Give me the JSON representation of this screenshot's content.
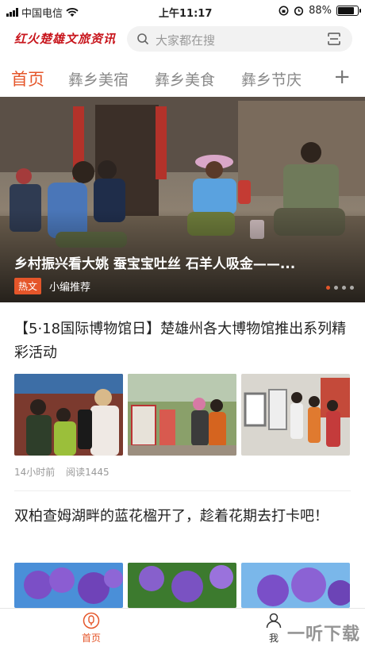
{
  "status_bar": {
    "carrier": "中国电信",
    "time": "上午11:17",
    "battery": "88%",
    "battery_level": 0.88
  },
  "header": {
    "logo_text": "红火楚雄文旅资讯",
    "search_placeholder": "大家都在搜"
  },
  "tabs": [
    {
      "label": "首页",
      "active": true
    },
    {
      "label": "彝乡美宿",
      "active": false
    },
    {
      "label": "彝乡美食",
      "active": false
    },
    {
      "label": "彝乡节庆",
      "active": false
    }
  ],
  "tab_more_icon": "plus-icon",
  "hero": {
    "caption": "乡村振兴看大姚 蚕宝宝吐丝 石羊人吸金——...",
    "badge": "热文",
    "source": "小编推荐",
    "slide_count": 4,
    "active_slide": 1
  },
  "articles": [
    {
      "title": "【5·18国际博物馆日】楚雄州各大博物馆推出系列精彩活动",
      "time": "14小时前",
      "reads": "阅读1445"
    },
    {
      "title": "双柏查姆湖畔的蓝花楹开了，趁着花期去打卡吧！"
    }
  ],
  "bottom_nav": {
    "home": "首页",
    "me": "我",
    "watermark": "一听下载"
  },
  "colors": {
    "accent": "#e5562a",
    "logo_red": "#c8161d"
  }
}
